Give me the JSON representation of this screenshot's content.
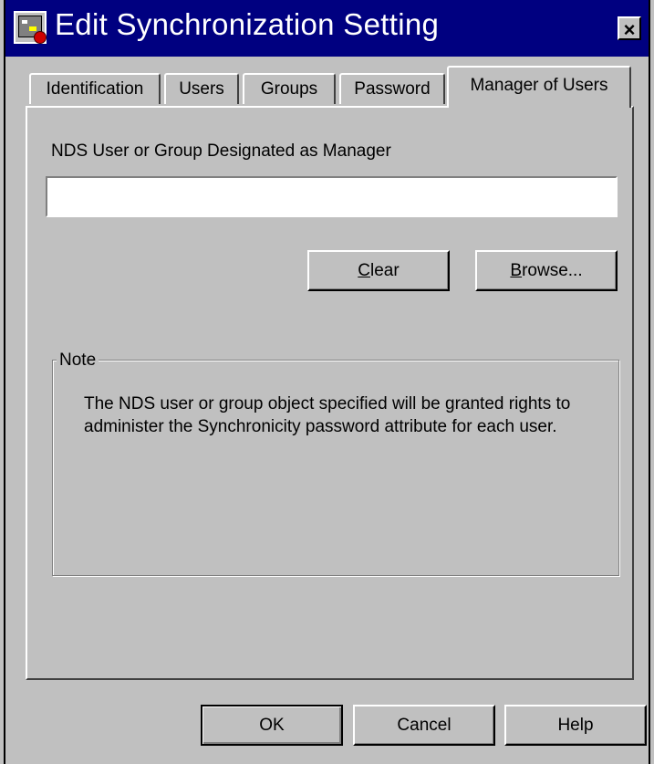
{
  "window": {
    "title": "Edit Synchronization Setting",
    "close_glyph": "×",
    "title_icon": "app-icon"
  },
  "tabs": [
    {
      "label": "Identification",
      "active": false
    },
    {
      "label": "Users",
      "active": false
    },
    {
      "label": "Groups",
      "active": false
    },
    {
      "label": "Password",
      "active": false
    },
    {
      "label": "Manager of Users",
      "active": true
    }
  ],
  "manager": {
    "label": "NDS User or Group Designated as Manager",
    "value": "",
    "clear_mnemonic": "C",
    "clear_rest": "lear",
    "browse_mnemonic": "B",
    "browse_rest": "rowse..."
  },
  "note": {
    "legend": "Note",
    "text": "The NDS user or group object specified will be granted rights to administer the Synchronicity password attribute for each user."
  },
  "footer": {
    "ok": "OK",
    "cancel": "Cancel",
    "help": "Help"
  }
}
